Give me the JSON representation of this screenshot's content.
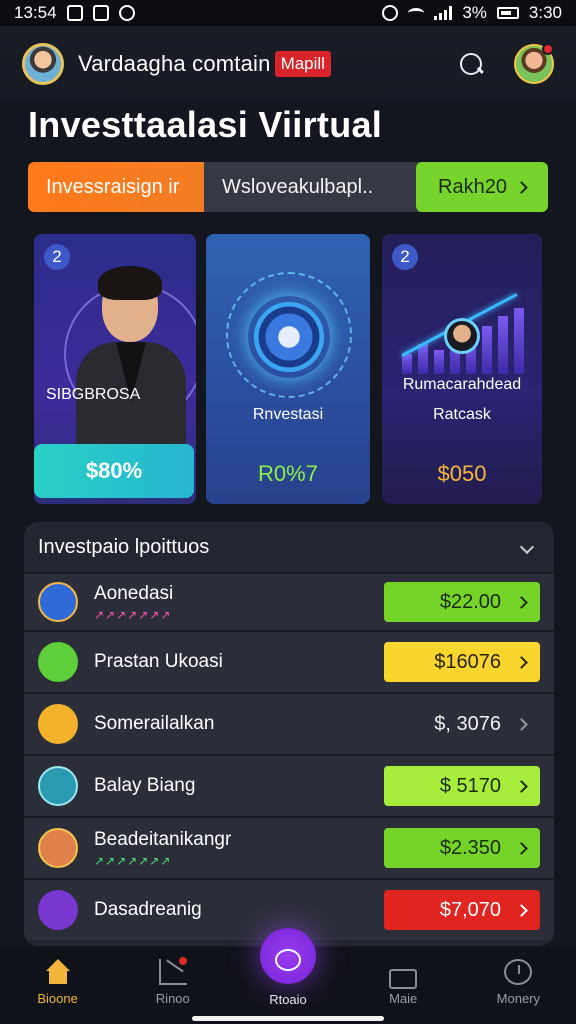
{
  "status_bar": {
    "time": "13:54",
    "battery": "3%",
    "clock_right": "3:30",
    "icons": [
      "image-icon",
      "notification-icon",
      "location-icon",
      "alarm-icon",
      "wifi-icon",
      "signal-icon",
      "battery-icon"
    ]
  },
  "header": {
    "title": "Vardaagha comtain",
    "badge": "Mapill",
    "search_icon": "search-icon",
    "profile_notification": true
  },
  "page_title": "Investtaalasi Viirtual",
  "segment_bar": {
    "left_label": "Invessraisign ir",
    "middle_label": "Wsloveakulbapl..",
    "right_label": "Rakh20"
  },
  "cards": [
    {
      "number": "2",
      "label": "SIBGBROSA",
      "amount": "$80%"
    },
    {
      "label": "Rnvestasi",
      "amount": "R0%7"
    },
    {
      "number": "2",
      "label_1": "Rumacarahdead",
      "label_2": "Ratcask",
      "amount": "$050"
    }
  ],
  "portfolio": {
    "title": "Investpaio lpoittuos",
    "rows": [
      {
        "name": "Aonedasi",
        "sub": "↗↗↗↗↗↗↗",
        "value": "$22.00",
        "style": "green"
      },
      {
        "name": "Prastan Ukoasi",
        "sub": "",
        "value": "$16076",
        "style": "yellow"
      },
      {
        "name": "Somerailalkan",
        "sub": "",
        "value": "$, 3076",
        "style": "plain"
      },
      {
        "name": "Balay Biang",
        "sub": "",
        "value": "$ 5170",
        "style": "lime"
      },
      {
        "name": "Beadeitanikangr",
        "sub": "↗↗↗↗↗↗↗",
        "value": "$2.350",
        "style": "green"
      },
      {
        "name": "Dasadreanig",
        "sub": "",
        "value": "$7,070",
        "style": "red"
      }
    ]
  },
  "bottom_nav": {
    "items": [
      {
        "label": "Bioone",
        "icon": "home-icon",
        "active": true
      },
      {
        "label": "Rinoo",
        "icon": "chart-icon",
        "active": false
      },
      {
        "label": "Rtoaio",
        "icon": "planet-icon",
        "active": false
      },
      {
        "label": "Maie",
        "icon": "bag-icon",
        "active": false
      },
      {
        "label": "Monery",
        "icon": "clock-icon",
        "active": false
      }
    ]
  },
  "colors": {
    "background": "#14161f",
    "orange": "#ff7a1a",
    "green": "#76d42c",
    "yellow": "#f9d62e",
    "red": "#e0241f",
    "teal": "#2ad0c6",
    "purple": "#7424d8"
  }
}
